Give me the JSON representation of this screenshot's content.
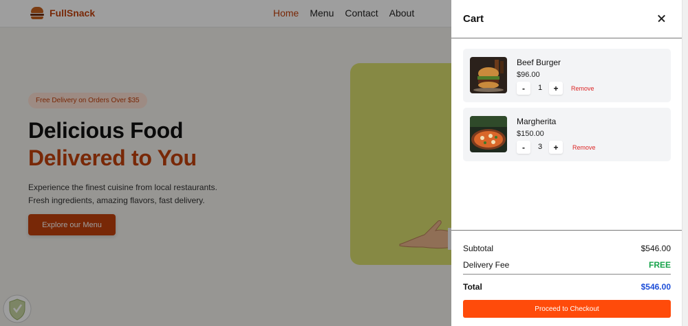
{
  "navbar": {
    "brand": "FullSnack",
    "links": [
      {
        "label": "Home"
      },
      {
        "label": "Menu"
      },
      {
        "label": "Contact"
      },
      {
        "label": "About"
      }
    ]
  },
  "hero": {
    "badge": "Free Delivery on Orders Over $35",
    "title_line1": "Delicious Food",
    "title_line2": "Delivered to You",
    "desc_line1": "Experience the finest cuisine from local restaurants.",
    "desc_line2": "Fresh ingredients, amazing flavors, fast delivery.",
    "cta": "Explore our Menu"
  },
  "cart": {
    "title": "Cart",
    "items": [
      {
        "name": "Beef Burger",
        "price": "$96.00",
        "qty": "1",
        "minus": "-",
        "plus": "+",
        "remove": "Remove"
      },
      {
        "name": "Margherita",
        "price": "$150.00",
        "qty": "3",
        "minus": "-",
        "plus": "+",
        "remove": "Remove"
      }
    ],
    "summary": {
      "subtotal_label": "Subtotal",
      "subtotal_value": "$546.00",
      "delivery_label": "Delivery Fee",
      "delivery_value": "FREE",
      "total_label": "Total",
      "total_value": "$546.00"
    },
    "checkout": "Proceed to Checkout"
  },
  "colors": {
    "brand": "#c2410c",
    "checkout": "#ff4b0a",
    "free": "#16a34a",
    "total": "#1d4ed8",
    "remove": "#dc2626"
  },
  "icons": [
    "burger-logo-icon",
    "close-icon",
    "hand-icon",
    "shield-icon"
  ]
}
